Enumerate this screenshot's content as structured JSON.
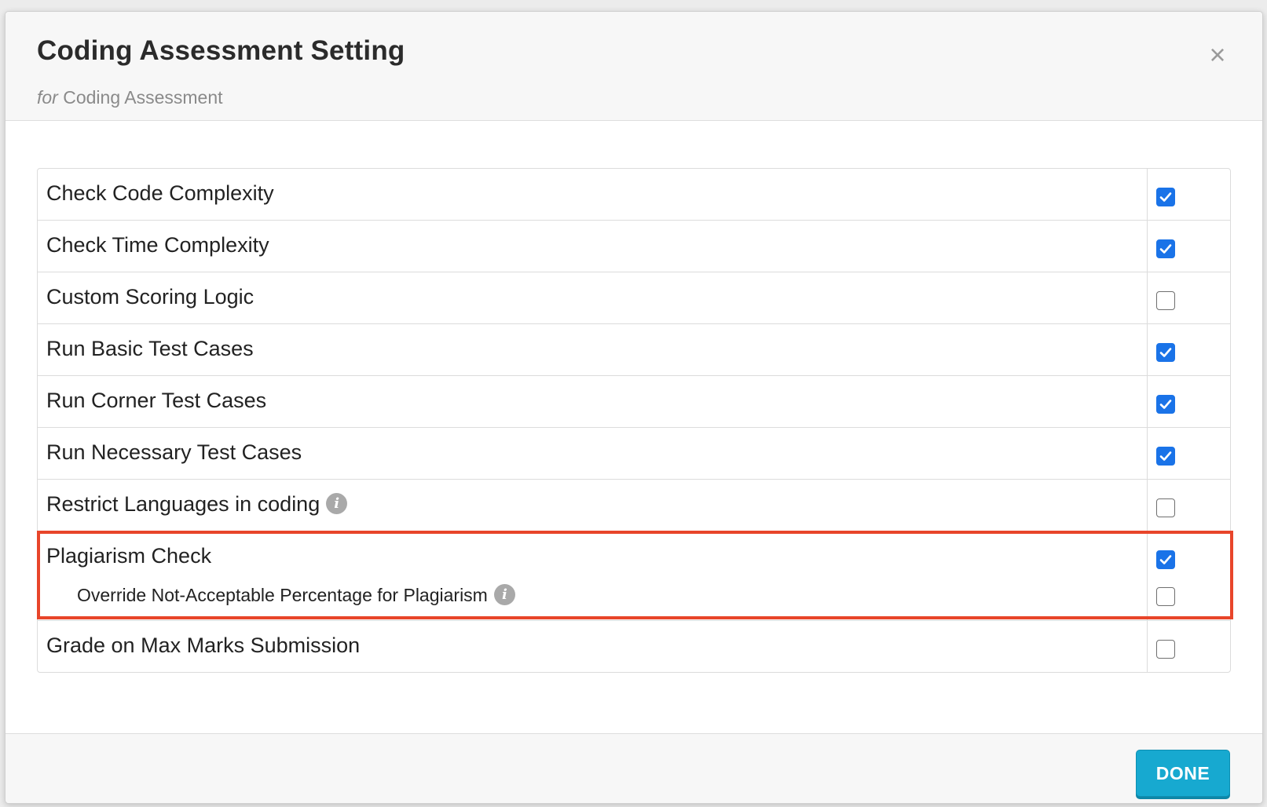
{
  "dialog": {
    "title": "Coding Assessment Setting",
    "subtitle_prefix": "for",
    "subtitle": "Coding Assessment",
    "close_symbol": "×"
  },
  "settings": [
    {
      "label": "Check Code Complexity",
      "checked": true
    },
    {
      "label": "Check Time Complexity",
      "checked": true
    },
    {
      "label": "Custom Scoring Logic",
      "checked": false
    },
    {
      "label": "Run Basic Test Cases",
      "checked": true
    },
    {
      "label": "Run Corner Test Cases",
      "checked": true
    },
    {
      "label": "Run Necessary Test Cases",
      "checked": true
    },
    {
      "label": "Restrict Languages in coding",
      "checked": false,
      "info_icon": "info-icon"
    },
    {
      "label": "Plagiarism Check",
      "checked": true,
      "highlighted": true,
      "sub_option": {
        "label": "Override Not-Acceptable Percentage for Plagiarism",
        "checked": false,
        "info_icon": "info-icon"
      }
    },
    {
      "label": "Grade on Max Marks Submission",
      "checked": false
    }
  ],
  "info_glyph": "i",
  "footer": {
    "done_label": "DONE"
  },
  "colors": {
    "checkbox_checked": "#1a73e8",
    "highlight_border": "#e8452a",
    "done_button": "#17a9d0"
  }
}
